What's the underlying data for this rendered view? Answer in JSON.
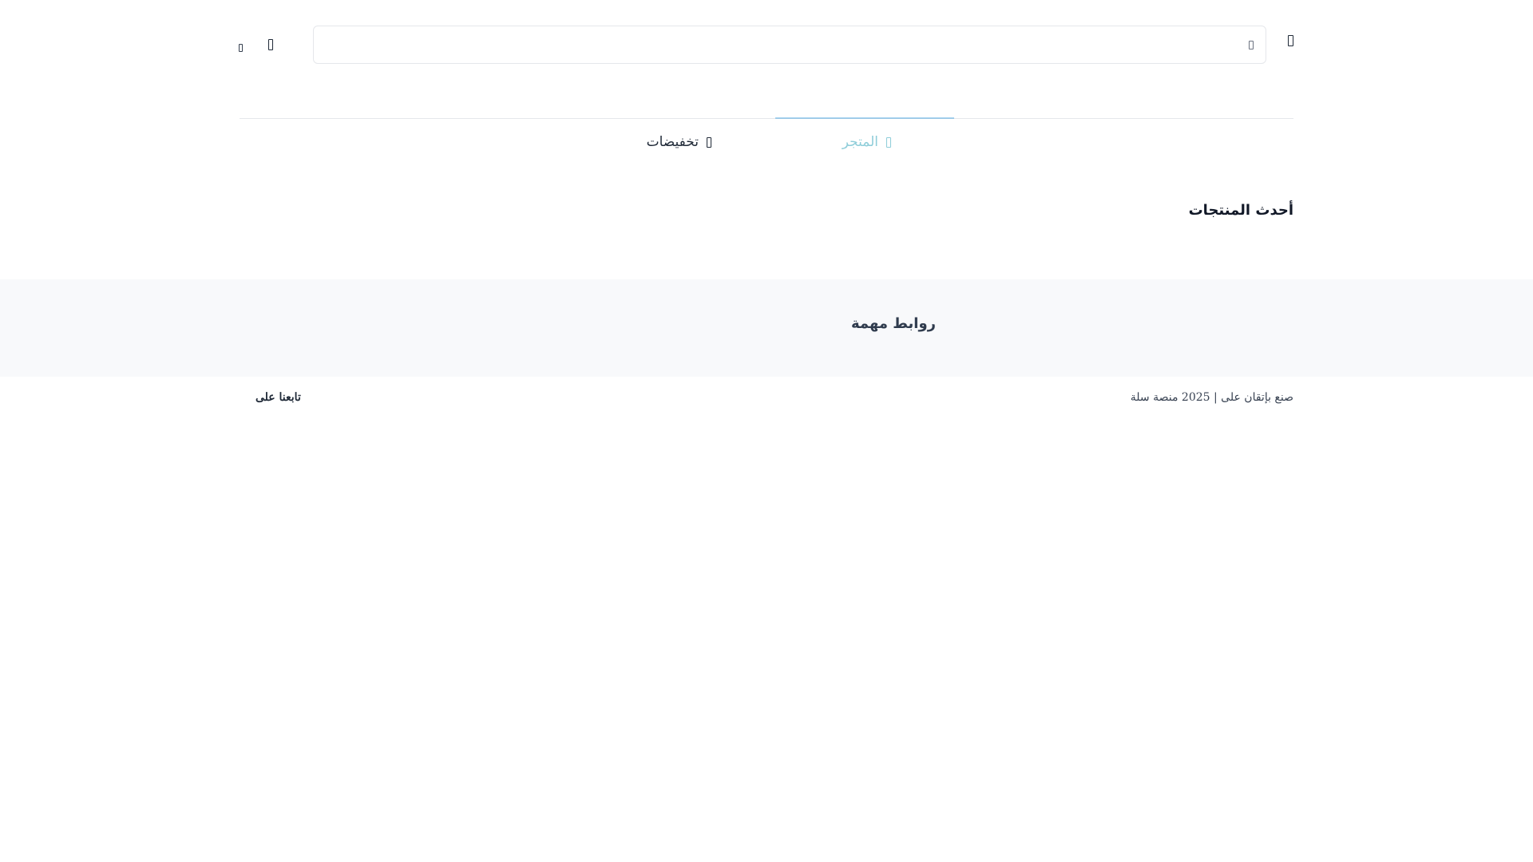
{
  "header": {
    "menu_icon": "menu-icon",
    "search": {
      "placeholder": "",
      "value": "",
      "icon": "search-icon"
    },
    "user_icon": "user-icon",
    "cart_icon": "cart-icon"
  },
  "nav": {
    "items": [
      {
        "label": "المتجر",
        "icon": "store-icon",
        "active": true
      },
      {
        "label": "تخفيضات",
        "icon": "tag-icon",
        "active": false
      }
    ],
    "active_color": "#8ecdd9"
  },
  "main": {
    "latest_products_title": "أحدث المنتجات"
  },
  "footer": {
    "links_heading": "روابط مهمة",
    "copyright": "صنع بإتقان على | 2025 منصة سلة",
    "follow_label": "تابعنا على",
    "band_color": "#f8f9fb"
  }
}
